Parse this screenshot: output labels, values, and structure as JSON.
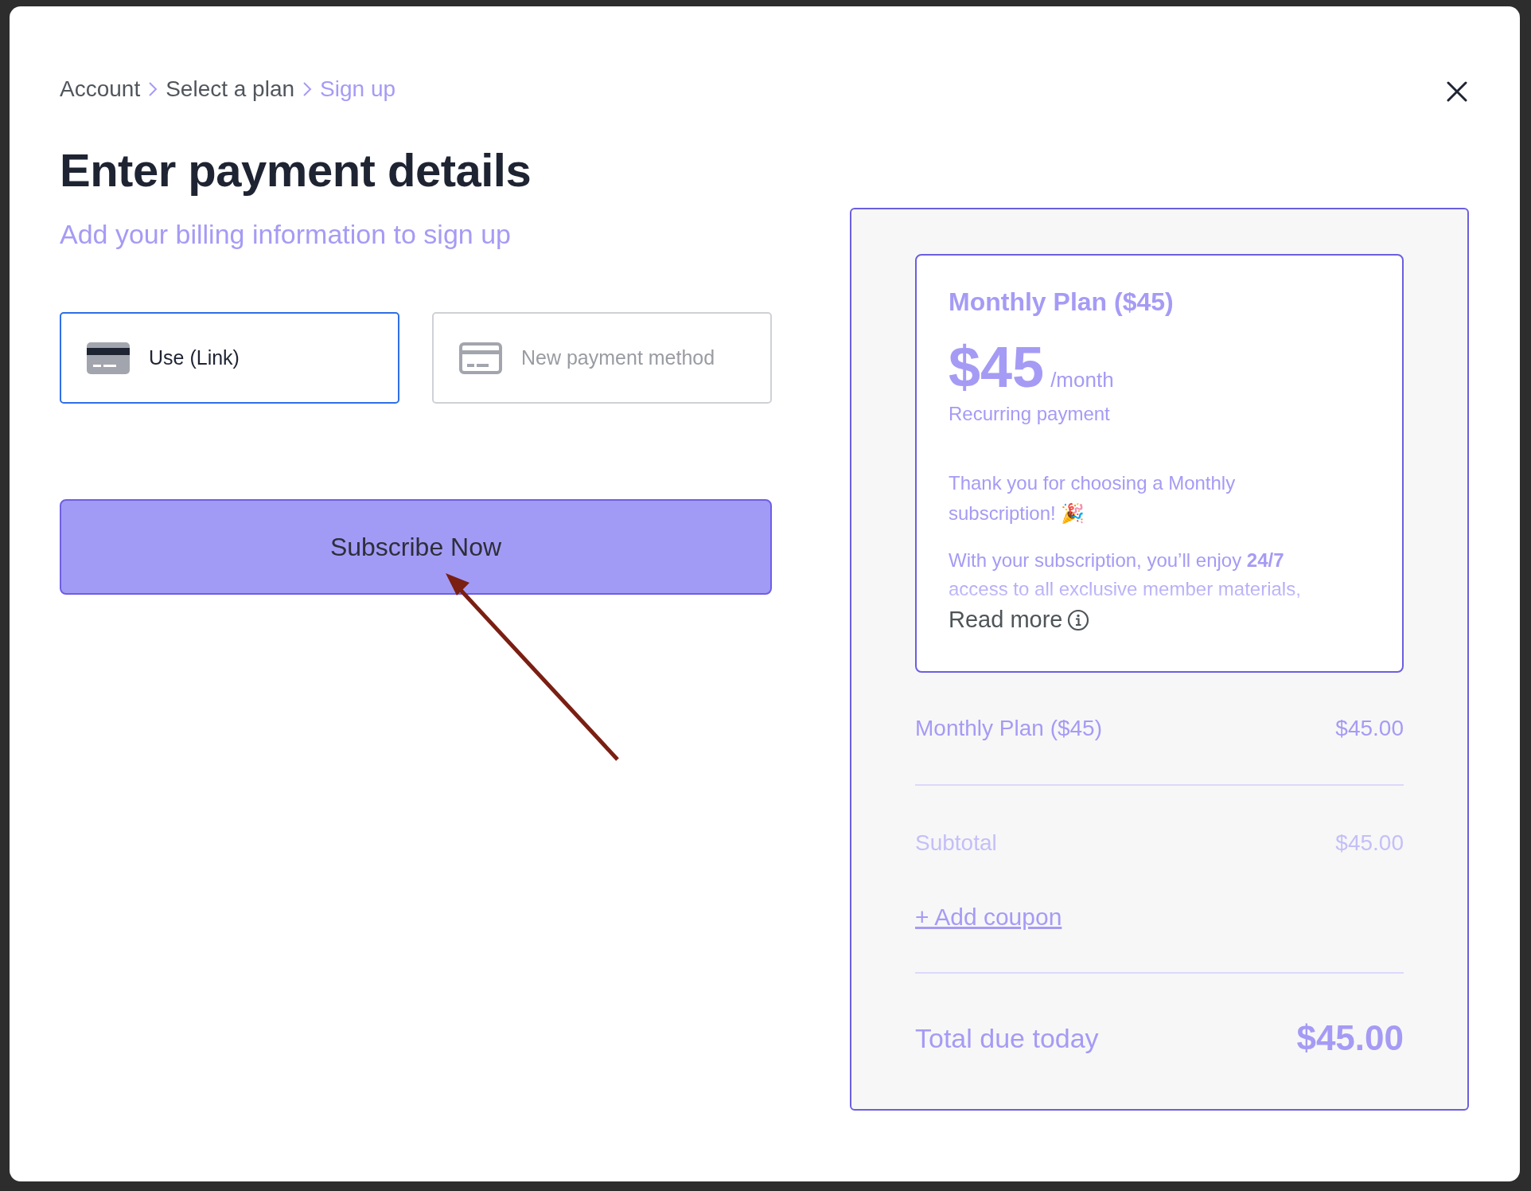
{
  "breadcrumb": [
    {
      "label": "Account",
      "selected": false
    },
    {
      "label": "Select a plan",
      "selected": false
    },
    {
      "label": "Sign up",
      "selected": true
    }
  ],
  "title": "Enter payment details",
  "subtitle": "Add your billing information to sign up",
  "payment_methods": [
    {
      "label": "Use (Link)",
      "selected": true
    },
    {
      "label": "New payment method",
      "selected": false
    }
  ],
  "subscribe_button": "Subscribe Now",
  "plan_card": {
    "name": "Monthly Plan ($45)",
    "price": "$45",
    "period": "/month",
    "billing": "Recurring payment",
    "thanks": "Thank you for choosing a Monthly subscription! 🎉",
    "details": "With your subscription, you’ll enjoy **24/7** access to all exclusive member materials,",
    "read_more": "Read more"
  },
  "summary": {
    "line_item": {
      "label": "Monthly Plan ($45)",
      "amount": "$45.00"
    },
    "subtotal": {
      "label": "Subtotal",
      "amount": "$45.00"
    },
    "coupon_link": "+ Add coupon",
    "total": {
      "label": "Total due today",
      "amount": "$45.00"
    }
  }
}
